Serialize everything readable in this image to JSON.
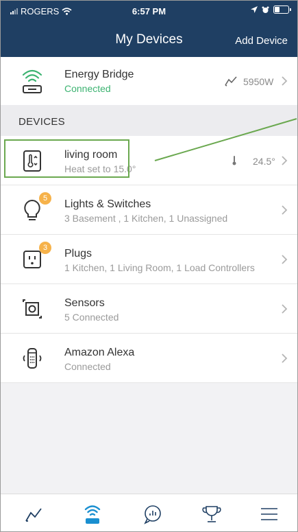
{
  "status": {
    "carrier": "ROGERS",
    "time": "6:57 PM"
  },
  "nav": {
    "title": "My Devices",
    "add_label": "Add Device"
  },
  "bridge": {
    "name": "Energy Bridge",
    "status": "Connected",
    "power": "5950W"
  },
  "section": {
    "label": "DEVICES"
  },
  "devices": [
    {
      "name": "living room",
      "sub": "Heat set to 15.0°",
      "value": "24.5°",
      "icon": "thermostat-icon"
    },
    {
      "name": "Lights & Switches",
      "sub": "3 Basement , 1 Kitchen, 1 Unassigned",
      "badge": "5",
      "icon": "lightbulb-icon"
    },
    {
      "name": "Plugs",
      "sub": "1 Kitchen, 1 Living Room, 1 Load Controllers",
      "badge": "3",
      "icon": "plug-icon"
    },
    {
      "name": "Sensors",
      "sub": "5 Connected",
      "icon": "sensor-icon"
    },
    {
      "name": "Amazon Alexa",
      "sub": "Connected",
      "icon": "alexa-icon"
    }
  ],
  "colors": {
    "header": "#1f3f63",
    "accent": "#1a8fd0",
    "connected": "#3cb371",
    "badge": "#f6b24a",
    "annotation": "#6aa84f"
  },
  "tabs": [
    "usage-icon",
    "devices-icon",
    "insights-icon",
    "rewards-icon",
    "menu-icon"
  ]
}
